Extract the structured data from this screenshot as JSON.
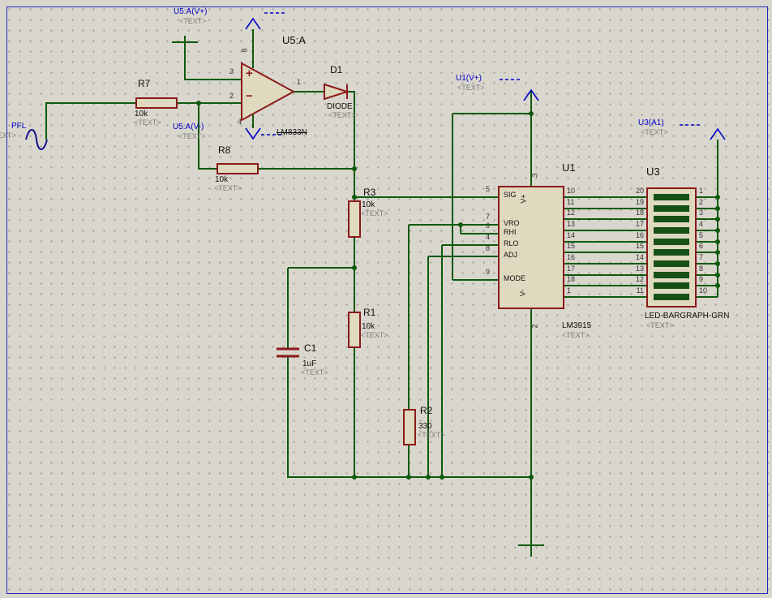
{
  "power_labels": {
    "u5a_vplus": {
      "label": "U5:A(V+)",
      "placeholder": "<TEXT>"
    },
    "u5a_vminus": {
      "label": "U5:A(V-)",
      "placeholder": "<TEXT>"
    },
    "u1_vplus": {
      "label": "U1(V+)",
      "placeholder": "<TEXT>"
    },
    "u3_a1": {
      "label": "U3(A1)",
      "placeholder": "<TEXT>"
    },
    "pfl": {
      "label": "PFL",
      "placeholder": "<TEXT>"
    }
  },
  "components": {
    "u5a": {
      "ref": "U5:A",
      "value": "LM833N",
      "plus": "+",
      "minus": "−",
      "pins": {
        "noninv": "3",
        "inv": "2",
        "out": "1",
        "vplus": "8",
        "vminus": "4"
      }
    },
    "r7": {
      "ref": "R7",
      "value": "10k",
      "placeholder": "<TEXT>"
    },
    "r8": {
      "ref": "R8",
      "value": "10k",
      "placeholder": "<TEXT>"
    },
    "r3": {
      "ref": "R3",
      "value": "10k",
      "placeholder": "<TEXT>"
    },
    "r1": {
      "ref": "R1",
      "value": "10k",
      "placeholder": "<TEXT>"
    },
    "r2": {
      "ref": "R2",
      "value": "330",
      "placeholder": "<TEXT>"
    },
    "c1": {
      "ref": "C1",
      "value": "1uF",
      "placeholder": "<TEXT>"
    },
    "d1": {
      "ref": "D1",
      "value": "DIODE",
      "placeholder": "<TEXT>"
    },
    "u1": {
      "ref": "U1",
      "value": "LM3915",
      "placeholder": "<TEXT>",
      "left_pins": [
        {
          "name": "SIG",
          "num": "5"
        },
        {
          "name": "VRO",
          "num": "7"
        },
        {
          "name": "RHI",
          "num": "6"
        },
        {
          "name": "RLO",
          "num": "4"
        },
        {
          "name": "ADJ",
          "num": "8"
        },
        {
          "name": "MODE",
          "num": "9"
        }
      ],
      "top_pin": {
        "name": "V+",
        "num": "3"
      },
      "bottom_pin": {
        "name": "V-",
        "num": "2"
      },
      "right_pin_nums": [
        "10",
        "11",
        "12",
        "13",
        "14",
        "15",
        "16",
        "17",
        "18",
        "1"
      ]
    },
    "u3": {
      "ref": "U3",
      "value": "LED-BARGRAPH-GRN",
      "placeholder": "<TEXT>",
      "left_pin_nums": [
        "20",
        "19",
        "18",
        "17",
        "16",
        "15",
        "14",
        "13",
        "12",
        "11"
      ],
      "right_pin_nums": [
        "1",
        "2",
        "3",
        "4",
        "5",
        "6",
        "7",
        "8",
        "9",
        "10"
      ]
    }
  },
  "colors": {
    "wire": "#0e5a0e",
    "component_outline": "#8b1a1a",
    "component_fill": "#ded9bf",
    "net_label": "#0000c8",
    "placeholder_text": "#7d7d7d",
    "led_segment": "#175017",
    "background": "#d9d6cd",
    "sheet_border": "#2323bb"
  }
}
